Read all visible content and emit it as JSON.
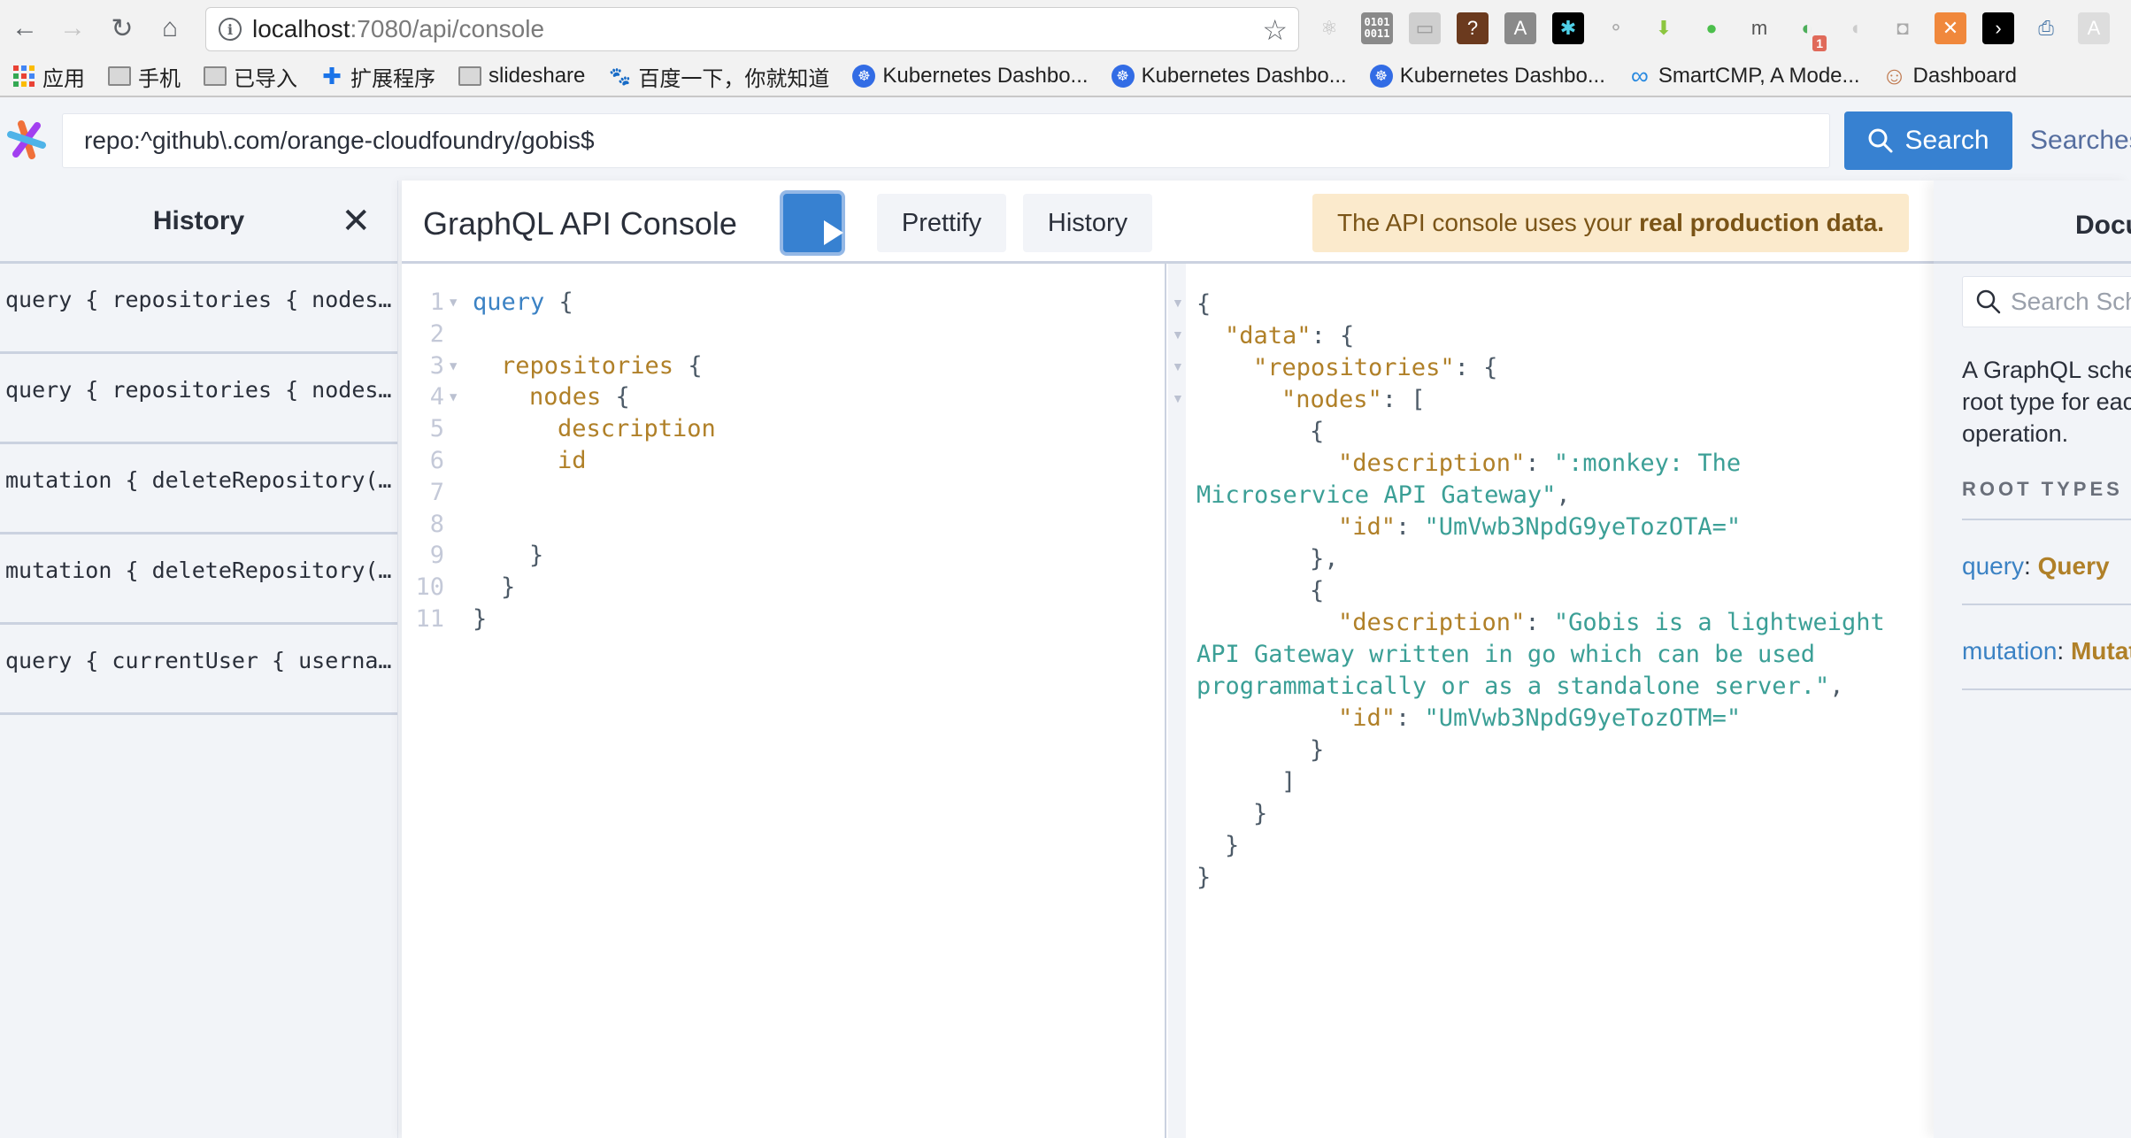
{
  "browser": {
    "url_host": "localhost",
    "url_path": ":7080/api/console",
    "extensions": [
      {
        "name": "react-devtools-icon",
        "glyph": "⚛",
        "bg": "#f2f2f2",
        "color": "#bbbbbb"
      },
      {
        "name": "binary-icon",
        "glyph": "01",
        "bg": "#8a8a8a",
        "color": "#ffffff"
      },
      {
        "name": "monitor-icon",
        "glyph": "▭",
        "bg": "#cfcfcf",
        "color": "#9a9a9a"
      },
      {
        "name": "help-diamond-icon",
        "glyph": "?",
        "bg": "#6b3a1e",
        "color": "#ffffff"
      },
      {
        "name": "angular-icon",
        "glyph": "A",
        "bg": "#8a8a8a",
        "color": "#ffffff"
      },
      {
        "name": "asterisk-colorful-icon",
        "glyph": "✱",
        "bg": "#000000",
        "color": "#4fd0e8"
      },
      {
        "name": "graph-nodes-icon",
        "glyph": "⚬",
        "bg": "#f2f2f2",
        "color": "#aaaaaa"
      },
      {
        "name": "download-arrow-icon",
        "glyph": "⬇",
        "bg": "#f2f2f2",
        "color": "#8cc63f"
      },
      {
        "name": "green-orb-icon",
        "glyph": "●",
        "bg": "#f2f2f2",
        "color": "#4cbf4c"
      },
      {
        "name": "m-letter-icon",
        "glyph": "m",
        "bg": "#f2f2f2",
        "color": "#555555"
      },
      {
        "name": "pushbullet-icon",
        "glyph": "◐",
        "bg": "#f2f2f2",
        "color": "#4cae5a",
        "badge": "1"
      },
      {
        "name": "grey-leaf-icon",
        "glyph": "◖",
        "bg": "#f2f2f2",
        "color": "#cccccc"
      },
      {
        "name": "octocat-bubble-icon",
        "glyph": "◘",
        "bg": "#f2f2f2",
        "color": "#aaaaaa"
      },
      {
        "name": "postman-icon",
        "glyph": "✕",
        "bg": "#f0883c",
        "color": "#ffffff"
      },
      {
        "name": "code-arrow-icon",
        "glyph": "›",
        "bg": "#000000",
        "color": "#ffffff"
      },
      {
        "name": "printer-icon",
        "glyph": "⎙",
        "bg": "#f2f2f2",
        "color": "#4a78a8"
      },
      {
        "name": "angular-grey-icon",
        "glyph": "A",
        "bg": "#dddddd",
        "color": "#ffffff"
      }
    ],
    "bookmarks": [
      {
        "label": "应用",
        "icon": "apps-grid-icon"
      },
      {
        "label": "手机",
        "icon": "folder-icon"
      },
      {
        "label": "已导入",
        "icon": "folder-icon"
      },
      {
        "label": "扩展程序",
        "icon": "puzzle-icon"
      },
      {
        "label": "slideshare",
        "icon": "folder-icon"
      },
      {
        "label": "百度一下，你就知道",
        "icon": "baidu-paw-icon"
      },
      {
        "label": "Kubernetes Dashbo...",
        "icon": "kubernetes-icon"
      },
      {
        "label": "Kubernetes Dashbo...",
        "icon": "kubernetes-icon"
      },
      {
        "label": "Kubernetes Dashbo...",
        "icon": "kubernetes-icon"
      },
      {
        "label": "SmartCMP, A Mode...",
        "icon": "smartcmp-icon"
      },
      {
        "label": "Dashboard",
        "icon": "jenkins-icon"
      }
    ]
  },
  "header": {
    "query_value": "repo:^github\\.com/orange-cloudfoundry/gobis$",
    "search_label": "Search",
    "searches_link": "Searches"
  },
  "history": {
    "title": "History",
    "items": [
      "query { repositories { nodes…",
      "query { repositories { nodes…",
      "mutation { deleteRepository(…",
      "mutation { deleteRepository(…",
      "query { currentUser { userna…"
    ]
  },
  "console": {
    "title": "GraphQL API Console",
    "prettify_label": "Prettify",
    "history_label": "History",
    "warning_text": "The API console uses your",
    "warning_bold": "real production data."
  },
  "editor": {
    "lines": [
      {
        "n": "1",
        "fold": true,
        "indent": 0,
        "tokens": [
          {
            "t": "query",
            "c": "kw"
          },
          {
            "t": " {",
            "c": "punc"
          }
        ]
      },
      {
        "n": "2",
        "fold": false,
        "indent": 0,
        "tokens": []
      },
      {
        "n": "3",
        "fold": true,
        "indent": 1,
        "tokens": [
          {
            "t": "repositories",
            "c": "field"
          },
          {
            "t": " {",
            "c": "punc"
          }
        ]
      },
      {
        "n": "4",
        "fold": true,
        "indent": 2,
        "tokens": [
          {
            "t": "nodes",
            "c": "field"
          },
          {
            "t": " {",
            "c": "punc"
          }
        ]
      },
      {
        "n": "5",
        "fold": false,
        "indent": 3,
        "tokens": [
          {
            "t": "description",
            "c": "field"
          }
        ]
      },
      {
        "n": "6",
        "fold": false,
        "indent": 3,
        "tokens": [
          {
            "t": "id",
            "c": "field"
          }
        ]
      },
      {
        "n": "7",
        "fold": false,
        "indent": 0,
        "tokens": []
      },
      {
        "n": "8",
        "fold": false,
        "indent": 0,
        "tokens": []
      },
      {
        "n": "9",
        "fold": false,
        "indent": 2,
        "tokens": [
          {
            "t": "}",
            "c": "punc"
          }
        ]
      },
      {
        "n": "10",
        "fold": false,
        "indent": 1,
        "tokens": [
          {
            "t": "}",
            "c": "punc"
          }
        ]
      },
      {
        "n": "11",
        "fold": false,
        "indent": 0,
        "tokens": [
          {
            "t": "}",
            "c": "punc"
          }
        ]
      }
    ]
  },
  "result": {
    "lines": [
      {
        "fold": true,
        "indent": 0,
        "tokens": [
          {
            "t": "{",
            "c": "punc"
          }
        ]
      },
      {
        "fold": true,
        "indent": 1,
        "tokens": [
          {
            "t": "\"data\"",
            "c": "key"
          },
          {
            "t": ": {",
            "c": "punc"
          }
        ]
      },
      {
        "fold": true,
        "indent": 2,
        "tokens": [
          {
            "t": "\"repositories\"",
            "c": "key"
          },
          {
            "t": ": {",
            "c": "punc"
          }
        ]
      },
      {
        "fold": true,
        "indent": 3,
        "tokens": [
          {
            "t": "\"nodes\"",
            "c": "key"
          },
          {
            "t": ": [",
            "c": "punc"
          }
        ]
      },
      {
        "fold": false,
        "indent": 4,
        "tokens": [
          {
            "t": "{",
            "c": "punc"
          }
        ]
      },
      {
        "fold": false,
        "indent": 5,
        "tokens": [
          {
            "t": "\"description\"",
            "c": "key"
          },
          {
            "t": ": ",
            "c": "punc"
          },
          {
            "t": "\":monkey: The Microservice API Gateway\"",
            "c": "str"
          },
          {
            "t": ",",
            "c": "punc"
          }
        ]
      },
      {
        "fold": false,
        "indent": 5,
        "tokens": [
          {
            "t": "\"id\"",
            "c": "key"
          },
          {
            "t": ": ",
            "c": "punc"
          },
          {
            "t": "\"UmVwb3NpdG9yeTozOTA=\"",
            "c": "str"
          }
        ]
      },
      {
        "fold": false,
        "indent": 4,
        "tokens": [
          {
            "t": "},",
            "c": "punc"
          }
        ]
      },
      {
        "fold": false,
        "indent": 4,
        "tokens": [
          {
            "t": "{",
            "c": "punc"
          }
        ]
      },
      {
        "fold": false,
        "indent": 5,
        "tokens": [
          {
            "t": "\"description\"",
            "c": "key"
          },
          {
            "t": ": ",
            "c": "punc"
          },
          {
            "t": "\"Gobis is a lightweight API Gateway written in go which can be used programmatically or as a standalone server.\"",
            "c": "str"
          },
          {
            "t": ",",
            "c": "punc"
          }
        ]
      },
      {
        "fold": false,
        "indent": 5,
        "tokens": [
          {
            "t": "\"id\"",
            "c": "key"
          },
          {
            "t": ": ",
            "c": "punc"
          },
          {
            "t": "\"UmVwb3NpdG9yeTozOTM=\"",
            "c": "str"
          }
        ]
      },
      {
        "fold": false,
        "indent": 4,
        "tokens": [
          {
            "t": "}",
            "c": "punc"
          }
        ]
      },
      {
        "fold": false,
        "indent": 3,
        "tokens": [
          {
            "t": "]",
            "c": "punc"
          }
        ]
      },
      {
        "fold": false,
        "indent": 2,
        "tokens": [
          {
            "t": "}",
            "c": "punc"
          }
        ]
      },
      {
        "fold": false,
        "indent": 1,
        "tokens": [
          {
            "t": "}",
            "c": "punc"
          }
        ]
      },
      {
        "fold": false,
        "indent": 0,
        "tokens": [
          {
            "t": "}",
            "c": "punc"
          }
        ]
      }
    ]
  },
  "docs": {
    "title": "Documentation Explorer",
    "search_placeholder": "Search Schema...",
    "description": "A GraphQL schema provides a root type for each kind of operation.",
    "section_label": "ROOT TYPES",
    "root_types": [
      {
        "name": "query",
        "type": "Query"
      },
      {
        "name": "mutation",
        "type": "Mutation"
      }
    ]
  },
  "colors": {
    "accent": "#3781d1",
    "warning_bg": "#fbeacc",
    "warning_text": "#7a5417",
    "keyword": "#3b82c4",
    "field": "#b08028",
    "string": "#3b9f96"
  }
}
